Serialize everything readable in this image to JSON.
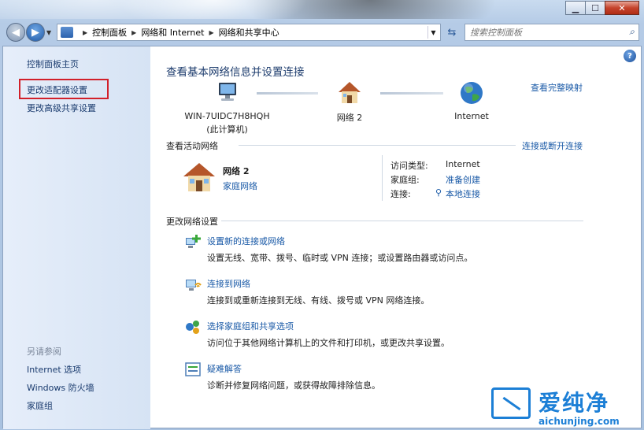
{
  "window": {
    "caption_buttons": [
      "minimize",
      "maximize",
      "close"
    ]
  },
  "address_bar": {
    "crumbs": [
      "控制面板",
      "网络和 Internet",
      "网络和共享中心"
    ],
    "search_placeholder": "搜索控制面板"
  },
  "sidebar": {
    "home": "控制面板主页",
    "adapter_settings": "更改适配器设置",
    "sharing_settings": "更改高级共享设置",
    "see_also_title": "另请参阅",
    "see_also": [
      "Internet 选项",
      "Windows 防火墙",
      "家庭组"
    ]
  },
  "main": {
    "title": "查看基本网络信息并设置连接",
    "full_map_link": "查看完整映射",
    "nodes": [
      {
        "label": "WIN-7UIDC7H8HQH",
        "sub": "(此计算机)",
        "icon": "computer-icon"
      },
      {
        "label": "网络  2",
        "icon": "house-icon"
      },
      {
        "label": "Internet",
        "icon": "globe-icon"
      }
    ],
    "active": {
      "heading": "查看活动网络",
      "connect_link": "连接或断开连接",
      "network_name": "网络  2",
      "network_type": "家庭网络",
      "access_type_label": "访问类型:",
      "access_type_value": "Internet",
      "homegroup_label": "家庭组:",
      "homegroup_value": "准备创建",
      "connections_label": "连接:",
      "connections_value": "本地连接"
    },
    "change": {
      "heading": "更改网络设置",
      "tasks": [
        {
          "link": "设置新的连接或网络",
          "desc": "设置无线、宽带、拨号、临时或 VPN 连接；或设置路由器或访问点。"
        },
        {
          "link": "连接到网络",
          "desc": "连接到或重新连接到无线、有线、拨号或 VPN 网络连接。"
        },
        {
          "link": "选择家庭组和共享选项",
          "desc": "访问位于其他网络计算机上的文件和打印机，或更改共享设置。"
        },
        {
          "link": "疑难解答",
          "desc": "诊断并修复网络问题，或获得故障排除信息。"
        }
      ]
    }
  },
  "watermark": {
    "cn": "爱纯净",
    "en": "aichunjing.com"
  }
}
